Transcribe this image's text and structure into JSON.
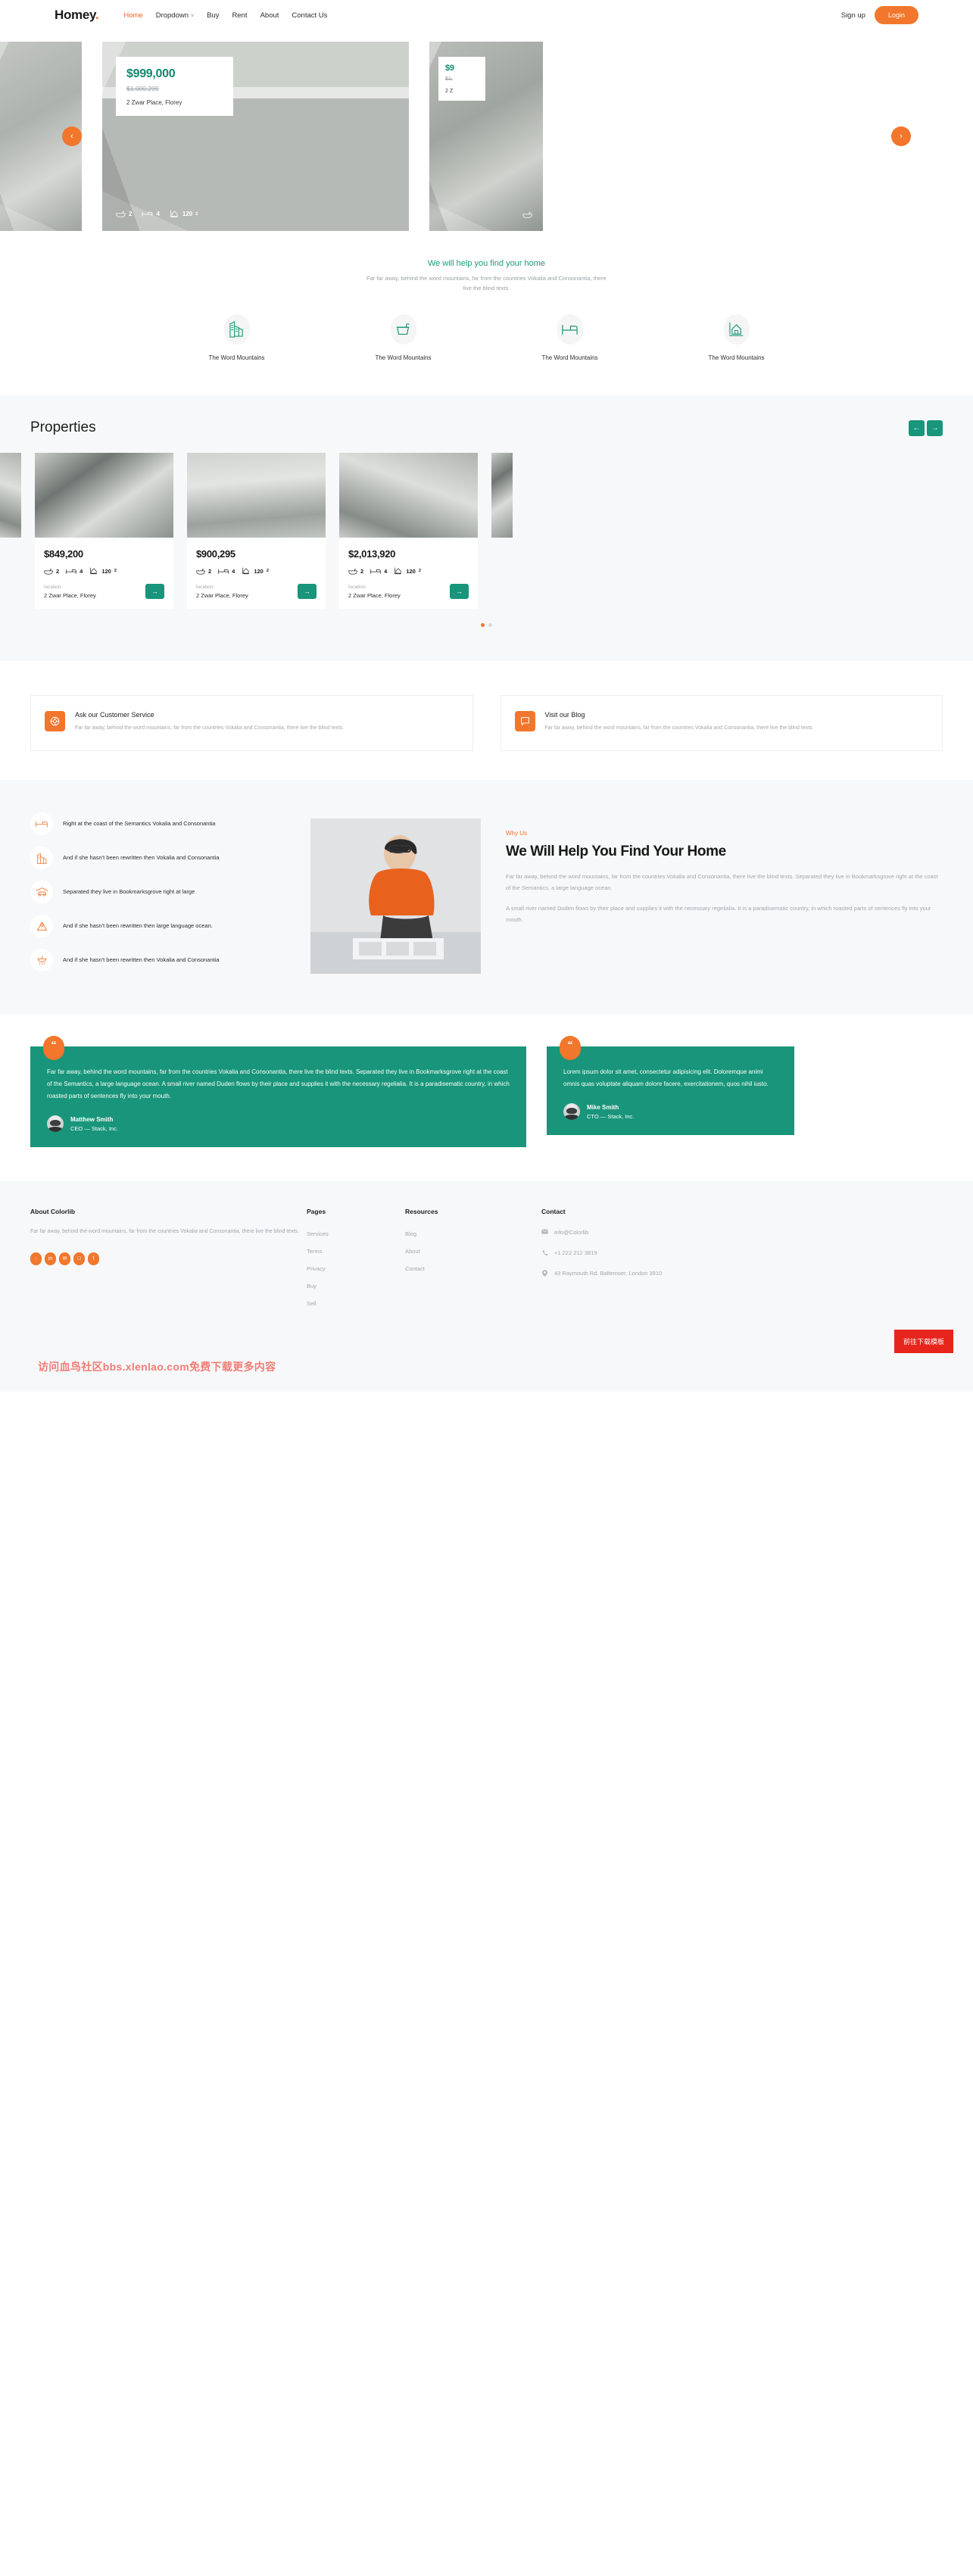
{
  "nav": {
    "logo": "Homey",
    "logo_dot": ".",
    "links": [
      {
        "label": "Home",
        "active": true
      },
      {
        "label": "Dropdown",
        "active": false,
        "caret": "˅"
      },
      {
        "label": "Buy",
        "active": false
      },
      {
        "label": "Rent",
        "active": false
      },
      {
        "label": "About",
        "active": false
      },
      {
        "label": "Contact Us",
        "active": false
      }
    ],
    "signup_label": "Sign up",
    "login_label": "Login"
  },
  "hero": {
    "prev_icon": "‹",
    "next_icon": "›",
    "slide": {
      "price": "$999,000",
      "old_price": "$1,000,299",
      "address": "2 Zwar Place, Florey",
      "baths": "2",
      "beds": "4",
      "area": "120",
      "area_sup": "2"
    },
    "side_slide": {
      "price": "$9",
      "old_price": "$1,",
      "address": "2 Z"
    }
  },
  "intro": {
    "heading": "We will help you find your home",
    "text": "Far far away, behind the word mountains, far from the countries Vokalia and Consonantia, there live the blind texts."
  },
  "features": [
    {
      "icon": "buildings-icon",
      "label": "The Word Mountains"
    },
    {
      "icon": "bathtub-icon",
      "label": "The Word Mountains"
    },
    {
      "icon": "bed-icon",
      "label": "The Word Mountains"
    },
    {
      "icon": "house-area-icon",
      "label": "The Word Mountains"
    }
  ],
  "properties": {
    "title": "Properties",
    "prev_icon": "←",
    "next_icon": "→",
    "location_label": "location:",
    "go_icon": "→",
    "cards": [
      {
        "price": "$849,200",
        "baths": "2",
        "beds": "4",
        "area": "120",
        "area_sup": "2",
        "address": "2 Zwar Place, Florey"
      },
      {
        "price": "$900,295",
        "baths": "2",
        "beds": "4",
        "area": "120",
        "area_sup": "2",
        "address": "2 Zwar Place, Florey"
      },
      {
        "price": "$2,013,920",
        "baths": "2",
        "beds": "4",
        "area": "120",
        "area_sup": "2",
        "address": "2 Zwar Place, Florey"
      }
    ]
  },
  "cta": [
    {
      "icon": "lifebuoy-icon",
      "title": "Ask our Customer Service",
      "text": "Far far away, behind the word mountains, far from the countries Vokalia and Consonantia, there live the blind texts."
    },
    {
      "icon": "chat-icon",
      "title": "Visit our Blog",
      "text": "Far far away, behind the word mountains, far from the countries Vokalia and Consonantia, there live the blind texts."
    }
  ],
  "whyus": {
    "kicker": "Why Us",
    "heading": "We Will Help You Find Your Home",
    "p1": "Far far away, behind the word mountains, far from the countries Vokalia and Consonantia, there live the blind texts. Separated they live in Bookmarksgrove right at the coast of the Semantics, a large language ocean.",
    "p2": "A small river named Duden flows by their place and supplies it with the necessary regelialia. It is a paradisematic country, in which roasted parts of sentences fly into your mouth.",
    "items": [
      {
        "icon": "bed-icon",
        "text": "Right at the coast of the Semantics Vokalia and Consonantia"
      },
      {
        "icon": "buildings-icon",
        "text": "And if she hasn't been rewritten then Vokalia and Consonantia"
      },
      {
        "icon": "garage-car-icon",
        "text": "Separated they live in Bookmarksgrove right at large"
      },
      {
        "icon": "map-pin-icon",
        "text": "And if she hasn't been rewritten then large language ocean."
      },
      {
        "icon": "shower-icon",
        "text": "And if she hasn't been rewritten then Vokalia and Consonantia"
      }
    ]
  },
  "testimonials": [
    {
      "quote_mark": "“",
      "text": "Far far away, behind the word mountains, far from the countries Vokalia and Consonantia, there live the blind texts. Separated they live in Bookmarksgrove right at the coast of the Semantics, a large language ocean. A small river named Duden flows by their place and supplies it with the necessary regelialia. It is a paradisematic country, in which roasted parts of sentences fly into your mouth.",
      "name": "Matthew Smith",
      "role": "CEO — Stack, Inc."
    },
    {
      "quote_mark": "“",
      "text": "Lorem ipsum dolor sit amet, consectetur adipisicing elit. Doloremque animi omnis quas voluptate aliquam dolore facere, exercitationem, quos nihil iusto.",
      "name": "Mike Smith",
      "role": "CTO — Stack, Inc."
    }
  ],
  "footer": {
    "about_head": "About Colorlib",
    "about_text": "Far far away, behind the word mountains, far from the countries Vokalia and Consonantia, there live the blind texts.",
    "socials": [
      {
        "icon": "dribbble-icon",
        "glyph": "◌"
      },
      {
        "icon": "linkedin-icon",
        "glyph": "in"
      },
      {
        "icon": "twitter-icon",
        "glyph": "✉"
      },
      {
        "icon": "instagram-icon",
        "glyph": "□"
      },
      {
        "icon": "facebook-icon",
        "glyph": "f"
      }
    ],
    "pages_head": "Pages",
    "pages": [
      "Services",
      "Terms",
      "Privacy",
      "Buy",
      "Sell"
    ],
    "resources_head": "Resources",
    "resources": [
      "Blog",
      "About",
      "Contact"
    ],
    "contact_head": "Contact",
    "contact": [
      {
        "icon": "mail-icon",
        "value": "info@Colorlib"
      },
      {
        "icon": "phone-icon",
        "value": "+1 222 212 3819"
      },
      {
        "icon": "pin-icon",
        "value": "43 Raymouth Rd. Baltemoer, London 3910"
      }
    ]
  },
  "watermark": {
    "text": "访问血鸟社区bbs.xlenlao.com免费下载更多内容",
    "button": "前往下载模板"
  }
}
